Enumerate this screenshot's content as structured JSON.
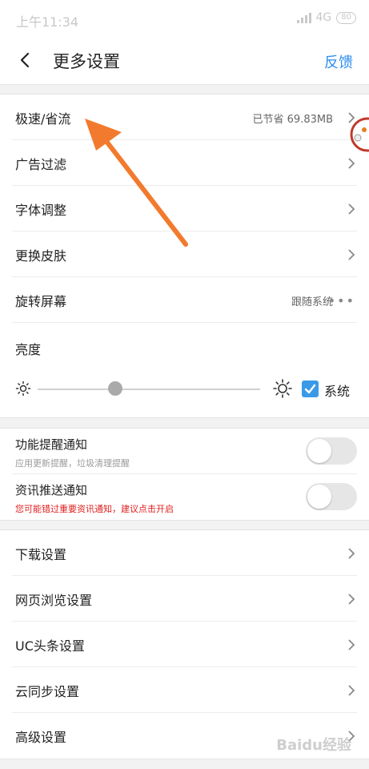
{
  "status_bar": {
    "time": "上午11:34",
    "network": "4G",
    "battery": "80"
  },
  "header": {
    "title": "更多设置",
    "feedback": "反馈"
  },
  "group1": {
    "speed": {
      "label": "极速/省流",
      "value": "已节省 69.83MB"
    },
    "ad_filter": {
      "label": "广告过滤"
    },
    "font_adjust": {
      "label": "字体调整"
    },
    "skin": {
      "label": "更换皮肤"
    },
    "rotate": {
      "label": "旋转屏幕",
      "value": "跟随系统",
      "more": "•••"
    },
    "brightness": {
      "label": "亮度",
      "level": 0.35,
      "system_label": "系统",
      "system_checked": true
    }
  },
  "group2": {
    "feature_notify": {
      "title": "功能提醒通知",
      "subtitle": "应用更新提醒，垃圾清理提醒",
      "enabled": false
    },
    "news_push": {
      "title": "资讯推送通知",
      "subtitle": "您可能错过重要资讯通知，建议点击开启",
      "enabled": false
    }
  },
  "group3": {
    "items": [
      {
        "label": "下载设置"
      },
      {
        "label": "网页浏览设置"
      },
      {
        "label": "UC头条设置"
      },
      {
        "label": "云同步设置"
      },
      {
        "label": "高级设置"
      }
    ]
  },
  "watermark": "Baidu经验",
  "colors": {
    "accent": "#2d8cf0",
    "checkbox": "#3a9ae8",
    "warning": "#e02020",
    "annotation_arrow": "#f27a2e"
  }
}
